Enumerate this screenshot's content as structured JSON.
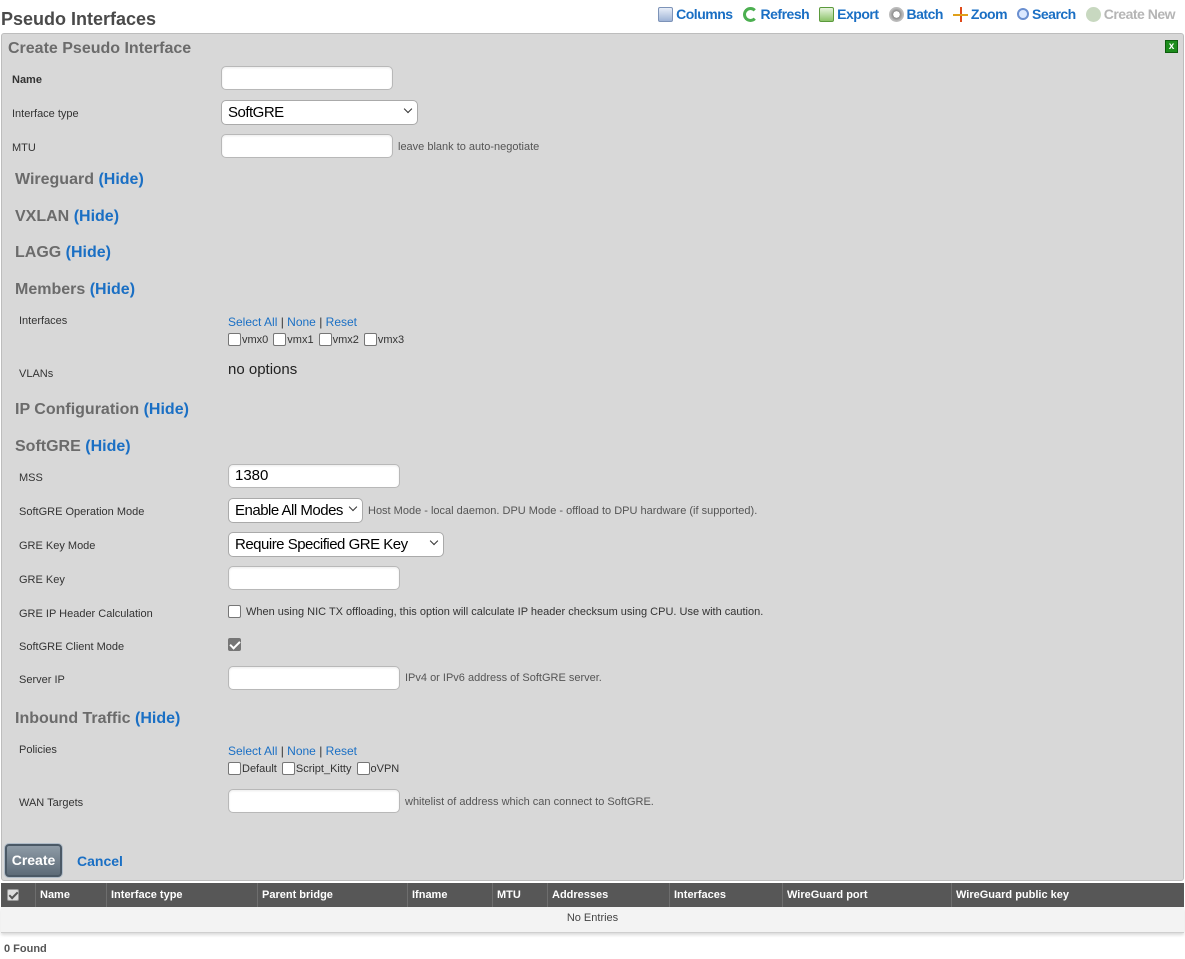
{
  "page": {
    "title": "Pseudo Interfaces"
  },
  "toolbar": {
    "columns": "Columns",
    "refresh": "Refresh",
    "export": "Export",
    "batch": "Batch",
    "zoom": "Zoom",
    "search": "Search",
    "create_new": "Create New"
  },
  "form": {
    "title": "Create Pseudo Interface",
    "close": "x",
    "name": {
      "label": "Name",
      "value": ""
    },
    "interface_type": {
      "label": "Interface type",
      "value": "SoftGRE"
    },
    "mtu": {
      "label": "MTU",
      "value": "",
      "hint": "leave blank to auto-negotiate"
    },
    "sections": {
      "hide": "(Hide)",
      "wireguard": "Wireguard",
      "vxlan": "VXLAN",
      "lagg": "LAGG",
      "members": "Members",
      "ip_config": "IP Configuration",
      "softgre": "SoftGRE",
      "inbound": "Inbound Traffic"
    },
    "links": {
      "select_all": "Select All",
      "none": "None",
      "reset": "Reset",
      "sep": "|"
    },
    "members": {
      "interfaces_label": "Interfaces",
      "interfaces": [
        "vmx0",
        "vmx1",
        "vmx2",
        "vmx3"
      ],
      "vlans_label": "VLANs",
      "vlans_value": "no options"
    },
    "softgre": {
      "mss": {
        "label": "MSS",
        "value": "1380"
      },
      "op_mode": {
        "label": "SoftGRE Operation Mode",
        "value": "Enable All Modes",
        "hint": "Host Mode - local daemon. DPU Mode - offload to DPU hardware (if supported)."
      },
      "key_mode": {
        "label": "GRE Key Mode",
        "value": "Require Specified GRE Key"
      },
      "gre_key": {
        "label": "GRE Key",
        "value": ""
      },
      "ip_header": {
        "label": "GRE IP Header Calculation",
        "hint": "When using NIC TX offloading, this option will calculate IP header checksum using CPU. Use with caution.",
        "checked": false
      },
      "client_mode": {
        "label": "SoftGRE Client Mode",
        "checked": true
      },
      "server_ip": {
        "label": "Server IP",
        "value": "",
        "hint": "IPv4 or IPv6 address of SoftGRE server."
      }
    },
    "inbound": {
      "policies_label": "Policies",
      "policies": [
        "Default",
        "Script_Kitty",
        "oVPN"
      ],
      "wan_targets": {
        "label": "WAN Targets",
        "value": "",
        "hint": "whitelist of address which can connect to SoftGRE."
      }
    },
    "buttons": {
      "create": "Create",
      "cancel": "Cancel"
    }
  },
  "table": {
    "columns": [
      "Name",
      "Interface type",
      "Parent bridge",
      "Ifname",
      "MTU",
      "Addresses",
      "Interfaces",
      "WireGuard port",
      "WireGuard public key"
    ],
    "empty": "No Entries",
    "found": "0 Found"
  }
}
